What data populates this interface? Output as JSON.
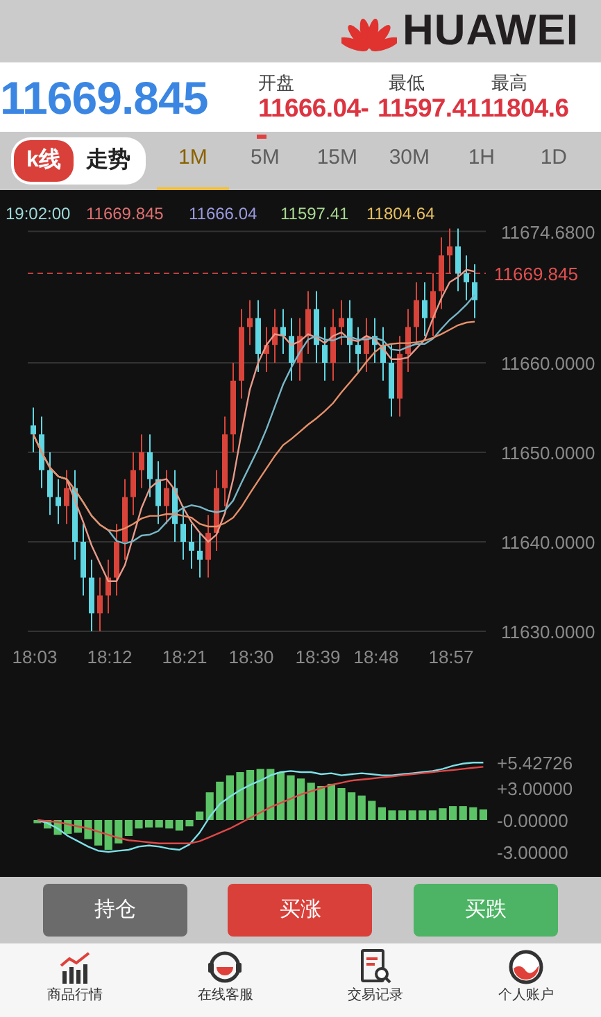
{
  "header": {
    "brand": "HUAWEI"
  },
  "quote": {
    "price": "11669.845",
    "stats": [
      {
        "label": "开盘",
        "value": "11666.04-"
      },
      {
        "label": "最低",
        "value": "11597.41"
      },
      {
        "label": "最高",
        "value": "11804.6"
      }
    ]
  },
  "modes": [
    {
      "label": "k线",
      "selected": true
    },
    {
      "label": "走势",
      "selected": false
    }
  ],
  "periods": [
    {
      "label": "1M",
      "selected": true,
      "marked": false
    },
    {
      "label": "5M",
      "selected": false,
      "marked": true
    },
    {
      "label": "15M",
      "selected": false,
      "marked": false
    },
    {
      "label": "30M",
      "selected": false,
      "marked": false
    },
    {
      "label": "1H",
      "selected": false,
      "marked": false
    },
    {
      "label": "1D",
      "selected": false,
      "marked": false
    }
  ],
  "price_chart": {
    "current_price_tag": "11669.845",
    "legend": [
      {
        "text": "19:02:00",
        "color": "#9fd9d9"
      },
      {
        "text": "11669.845",
        "color": "#e07070"
      },
      {
        "text": "11666.04",
        "color": "#9a9ae0"
      },
      {
        "text": "11597.41",
        "color": "#a8d890"
      },
      {
        "text": "11804.64",
        "color": "#e8c060"
      }
    ],
    "chart_data": {
      "type": "candlestick",
      "grid": true,
      "ylim": [
        11630,
        11674.68
      ],
      "ref_lines": [
        {
          "axis": "y",
          "value": 11670,
          "color": "#c04040"
        }
      ],
      "yticks": [
        {
          "value": 11674.68,
          "label": "11674.6800"
        },
        {
          "value": 11660,
          "label": "11660.0000"
        },
        {
          "value": 11650,
          "label": "11650.0000"
        },
        {
          "value": 11640,
          "label": "11640.0000"
        },
        {
          "value": 11630,
          "label": "11630.0000"
        }
      ],
      "categories": [
        "18:03",
        null,
        null,
        null,
        null,
        null,
        null,
        null,
        null,
        "18:12",
        null,
        null,
        null,
        null,
        null,
        null,
        null,
        null,
        "18:21",
        null,
        null,
        null,
        null,
        null,
        null,
        null,
        "18:30",
        null,
        null,
        null,
        null,
        null,
        null,
        null,
        "18:39",
        null,
        null,
        null,
        null,
        null,
        null,
        "18:48",
        null,
        null,
        null,
        null,
        null,
        null,
        null,
        null,
        "18:57",
        null,
        null,
        null
      ],
      "ohlc": [
        [
          11653,
          11655,
          11650,
          11652
        ],
        [
          11652,
          11654,
          11646,
          11648
        ],
        [
          11648,
          11650,
          11643,
          11645
        ],
        [
          11645,
          11647,
          11642,
          11644
        ],
        [
          11644,
          11648,
          11642,
          11646
        ],
        [
          11646,
          11648,
          11638,
          11640
        ],
        [
          11640,
          11642,
          11634,
          11636
        ],
        [
          11636,
          11638,
          11630,
          11632
        ],
        [
          11632,
          11636,
          11630,
          11634
        ],
        [
          11634,
          11638,
          11632,
          11636
        ],
        [
          11636,
          11642,
          11634,
          11640
        ],
        [
          11640,
          11647,
          11638,
          11645
        ],
        [
          11645,
          11650,
          11643,
          11648
        ],
        [
          11648,
          11652,
          11646,
          11650
        ],
        [
          11650,
          11652,
          11645,
          11647
        ],
        [
          11647,
          11649,
          11642,
          11644
        ],
        [
          11644,
          11648,
          11642,
          11646
        ],
        [
          11646,
          11648,
          11640,
          11642
        ],
        [
          11642,
          11644,
          11638,
          11640
        ],
        [
          11640,
          11642,
          11637,
          11639
        ],
        [
          11639,
          11641,
          11636,
          11638
        ],
        [
          11638,
          11643,
          11636,
          11641
        ],
        [
          11641,
          11648,
          11639,
          11646
        ],
        [
          11646,
          11654,
          11644,
          11652
        ],
        [
          11652,
          11660,
          11650,
          11658
        ],
        [
          11658,
          11666,
          11656,
          11664
        ],
        [
          11664,
          11667,
          11662,
          11665
        ],
        [
          11665,
          11667,
          11659,
          11661
        ],
        [
          11661,
          11664,
          11659,
          11662
        ],
        [
          11662,
          11666,
          11660,
          11664
        ],
        [
          11664,
          11666,
          11661,
          11663
        ],
        [
          11663,
          11665,
          11658,
          11660
        ],
        [
          11660,
          11665,
          11658,
          11663
        ],
        [
          11663,
          11668,
          11661,
          11666
        ],
        [
          11666,
          11668,
          11660,
          11662
        ],
        [
          11662,
          11664,
          11658,
          11660
        ],
        [
          11660,
          11666,
          11658,
          11664
        ],
        [
          11664,
          11667,
          11662,
          11665
        ],
        [
          11665,
          11667,
          11660,
          11662
        ],
        [
          11662,
          11664,
          11659,
          11661
        ],
        [
          11661,
          11665,
          11659,
          11663
        ],
        [
          11663,
          11665,
          11660,
          11662
        ],
        [
          11662,
          11664,
          11658,
          11660
        ],
        [
          11660,
          11662,
          11654,
          11656
        ],
        [
          11656,
          11663,
          11654,
          11661
        ],
        [
          11661,
          11666,
          11659,
          11664
        ],
        [
          11664,
          11669,
          11662,
          11667
        ],
        [
          11667,
          11669,
          11663,
          11665
        ],
        [
          11665,
          11670,
          11663,
          11668
        ],
        [
          11668,
          11674,
          11666,
          11672
        ],
        [
          11672,
          11675,
          11670,
          11673
        ],
        [
          11673,
          11675,
          11668,
          11670
        ],
        [
          11670,
          11672,
          11667,
          11669
        ],
        [
          11669,
          11671,
          11665,
          11667
        ]
      ],
      "series": [
        {
          "type": "line",
          "color": "#e89a8a",
          "values": [
            11652,
            11650,
            11648.3,
            11647.3,
            11647,
            11644.6,
            11642.2,
            11639.6,
            11637.6,
            11635.6,
            11635.6,
            11637.4,
            11640.6,
            11643.8,
            11646,
            11646.8,
            11647,
            11645.8,
            11643.8,
            11642.2,
            11641,
            11640,
            11640.8,
            11643.2,
            11647,
            11652.2,
            11657,
            11660,
            11662,
            11663.2,
            11663,
            11662,
            11662.4,
            11663.2,
            11662.8,
            11662.2,
            11663,
            11663.4,
            11662.6,
            11662.4,
            11663,
            11662.6,
            11661.6,
            11660.4,
            11660.4,
            11660.6,
            11661.6,
            11662.6,
            11665,
            11667.2,
            11669,
            11669.6,
            11670.4,
            11670.2
          ]
        },
        {
          "type": "line",
          "color": "#79b8c8",
          "values": [
            11652,
            11650,
            11648.3,
            11647.3,
            11647,
            11645.8,
            11644.4,
            11642.9,
            11641.9,
            11641.3,
            11640.1,
            11639.8,
            11640.1,
            11640.7,
            11640.8,
            11641.2,
            11642.2,
            11643.2,
            11643.8,
            11644.1,
            11643.9,
            11643.5,
            11643.3,
            11643.5,
            11644.6,
            11646.6,
            11648.5,
            11650.4,
            11652.6,
            11655.1,
            11657.6,
            11659.5,
            11661.2,
            11662.6,
            11663,
            11662.6,
            11662.5,
            11662.9,
            11662.9,
            11662.6,
            11662.6,
            11662.8,
            11662.5,
            11661.5,
            11661.4,
            11661.8,
            11662.1,
            11662.1,
            11662.7,
            11663.8,
            11664.8,
            11665.6,
            11666.5,
            11667.6
          ]
        },
        {
          "type": "line",
          "color": "#e8906a",
          "values": [
            11652,
            11650,
            11648.3,
            11647.3,
            11647,
            11645.8,
            11644.4,
            11642.9,
            11641.9,
            11641.3,
            11641.2,
            11641.5,
            11642,
            11642.6,
            11642.9,
            11642.9,
            11643.1,
            11643.1,
            11642.9,
            11642.7,
            11642,
            11641.7,
            11641.7,
            11642.1,
            11642.7,
            11643.9,
            11645.4,
            11646.8,
            11648.2,
            11649.6,
            11650.8,
            11651.5,
            11652.3,
            11653.1,
            11653.8,
            11654.6,
            11655.5,
            11656.7,
            11657.8,
            11658.9,
            11660.1,
            11661.2,
            11661.9,
            11662.1,
            11662.2,
            11662.2,
            11662.3,
            11662.5,
            11662.8,
            11663.2,
            11663.7,
            11664.2,
            11664.5,
            11664.6
          ]
        }
      ]
    }
  },
  "macd_chart": {
    "chart_data": {
      "type": "bar",
      "ylim": [
        -3,
        5.42726
      ],
      "yticks": [
        {
          "value": 5.42726,
          "label": "+5.42726"
        },
        {
          "value": 3,
          "label": "+3.00000"
        },
        {
          "value": 0,
          "label": "-0.00000"
        },
        {
          "value": -3,
          "label": "-3.00000"
        }
      ],
      "series": [
        {
          "color": "#5cc466",
          "values": [
            -0.3,
            -0.8,
            -1.4,
            -1.3,
            -1.2,
            -1.8,
            -2.4,
            -2.8,
            -2.2,
            -1.5,
            -0.8,
            -0.7,
            -0.7,
            -0.8,
            -1.0,
            -0.6,
            0.8,
            2.6,
            3.6,
            4.2,
            4.5,
            4.7,
            4.8,
            4.8,
            4.5,
            4.2,
            3.9,
            3.5,
            3.2,
            3.4,
            3.0,
            2.6,
            2.3,
            1.8,
            1.2,
            0.9,
            0.9,
            0.9,
            0.9,
            0.9,
            1.1,
            1.3,
            1.3,
            1.2,
            1.0
          ]
        },
        {
          "type": "line",
          "color": "#7fe0e8",
          "values": [
            0,
            -0.3,
            -0.8,
            -1.5,
            -2,
            -2.5,
            -2.9,
            -3,
            -2.9,
            -2.8,
            -2.5,
            -2.4,
            -2.5,
            -2.7,
            -2.8,
            -2.3,
            -1.2,
            0.3,
            1.5,
            2.2,
            2.8,
            3.3,
            3.7,
            4.2,
            4.5,
            4.6,
            4.5,
            4.5,
            4.3,
            4.4,
            4.2,
            4.3,
            4.4,
            4.3,
            4.2,
            4.2,
            4.3,
            4.4,
            4.5,
            4.6,
            4.8,
            5.1,
            5.3,
            5.4,
            5.4
          ]
        },
        {
          "type": "line",
          "color": "#e04848",
          "values": [
            0,
            -0.1,
            -0.2,
            -0.4,
            -0.6,
            -0.8,
            -1.1,
            -1.4,
            -1.7,
            -1.9,
            -2.0,
            -2.1,
            -2.2,
            -2.2,
            -2.2,
            -2.2,
            -2.0,
            -1.6,
            -1.2,
            -0.8,
            -0.3,
            0.2,
            0.7,
            1.2,
            1.6,
            2.0,
            2.4,
            2.7,
            3.0,
            3.3,
            3.5,
            3.7,
            3.8,
            3.9,
            4.0,
            4.1,
            4.2,
            4.3,
            4.4,
            4.5,
            4.6,
            4.7,
            4.8,
            4.9,
            5.0
          ]
        }
      ]
    }
  },
  "actions": [
    {
      "label": "持仓",
      "color": "#6b6b6b"
    },
    {
      "label": "买涨",
      "color": "#d9403a"
    },
    {
      "label": "买跌",
      "color": "#4cb464"
    }
  ],
  "nav": [
    {
      "label": "商品行情",
      "kind": "market"
    },
    {
      "label": "在线客服",
      "kind": "service"
    },
    {
      "label": "交易记录",
      "kind": "records"
    },
    {
      "label": "个人账户",
      "kind": "account"
    }
  ]
}
